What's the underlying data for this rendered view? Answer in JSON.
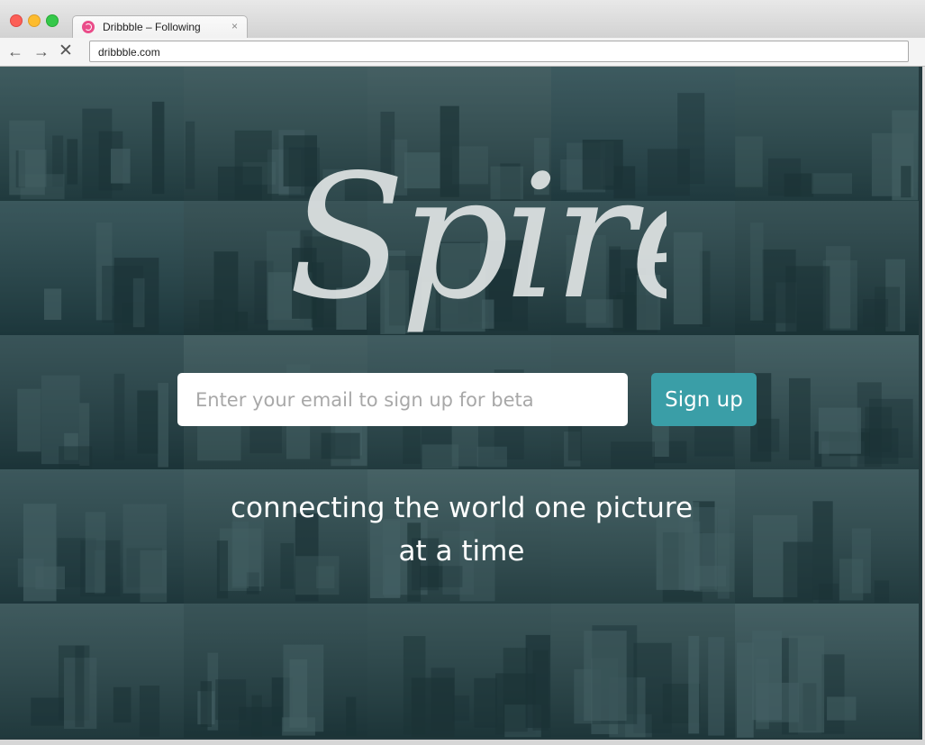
{
  "browser": {
    "tab_title": "Dribbble – Following",
    "tab_close": "×",
    "url": "dribbble.com",
    "back": "←",
    "forward": "→",
    "stop": "✕"
  },
  "hero": {
    "logo_text": "Spire",
    "email_placeholder": "Enter your email to sign up for beta",
    "email_value": "",
    "signup_label": "Sign up",
    "tagline_line1": "connecting the world one picture",
    "tagline_line2": "at a time"
  },
  "photos": [
    {
      "id": "paris-eiffel-1",
      "tone": "#3a5559"
    },
    {
      "id": "canal-city",
      "tone": "#435b5e"
    },
    {
      "id": "street-scene",
      "tone": "#4a6063"
    },
    {
      "id": "lake-bridge",
      "tone": "#36525a"
    },
    {
      "id": "paris-eiffel-2",
      "tone": "#3a5559"
    },
    {
      "id": "coast-cliffs",
      "tone": "#2d4a51"
    },
    {
      "id": "times-square",
      "tone": "#2b3f43"
    },
    {
      "id": "surfer",
      "tone": "#31474b"
    },
    {
      "id": "river-city-night",
      "tone": "#2f464b"
    },
    {
      "id": "forest",
      "tone": "#263b3f"
    },
    {
      "id": "nyc-bridge",
      "tone": "#2a4046"
    },
    {
      "id": "beach-crowd",
      "tone": "#4a6063"
    },
    {
      "id": "lake-mountain",
      "tone": "#3f575c"
    },
    {
      "id": "amsterdam-houses",
      "tone": "#3e5458"
    },
    {
      "id": "waterfall",
      "tone": "#4d6468"
    },
    {
      "id": "bangkok-temple",
      "tone": "#324a50"
    },
    {
      "id": "hollywood-sign",
      "tone": "#3f565a"
    },
    {
      "id": "sydney-harbour",
      "tone": "#4e6669"
    },
    {
      "id": "pool-dock",
      "tone": "#4f686b"
    },
    {
      "id": "misty-path",
      "tone": "#3e5559"
    },
    {
      "id": "tokyo-signs",
      "tone": "#3b5155"
    },
    {
      "id": "night-street",
      "tone": "#2a3f43"
    },
    {
      "id": "zipline",
      "tone": "#2e4447"
    },
    {
      "id": "tunnel-bridge",
      "tone": "#34494c"
    },
    {
      "id": "children-walking",
      "tone": "#4a6165"
    }
  ]
}
